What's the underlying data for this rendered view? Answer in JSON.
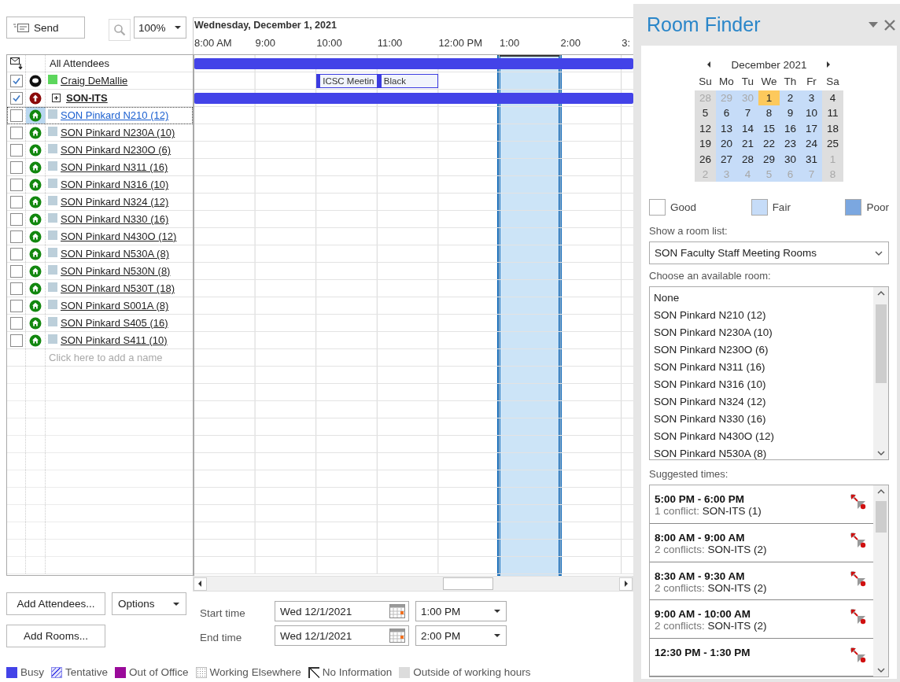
{
  "toolbar": {
    "send": "Send",
    "zoom": "100%"
  },
  "schedule": {
    "date": "Wednesday, December 1, 2021",
    "hours": [
      "8:00 AM",
      "9:00",
      "10:00",
      "11:00",
      "12:00 PM",
      "1:00",
      "2:00",
      "3:"
    ]
  },
  "attendees_header": {
    "label": "All Attendees",
    "busy": true
  },
  "attendees": [
    {
      "name": "Craig DeMallie",
      "kind": "person",
      "checked": true,
      "color": "#5cd65c",
      "selected": false,
      "slots": [
        {
          "kind": "free"
        },
        {
          "kind": "free"
        },
        {
          "kind": "tentative",
          "label": "ICSC Meetin"
        },
        {
          "kind": "tentative",
          "label": "Black"
        }
      ]
    },
    {
      "name": "SON-ITS",
      "kind": "group",
      "checked": true,
      "expanded": false,
      "selected": false,
      "busy": true
    },
    {
      "name": "SON Pinkard N210 (12)",
      "kind": "room",
      "checked": false,
      "color": "#bccfda",
      "selected": true
    },
    {
      "name": "SON Pinkard N230A (10)",
      "kind": "room",
      "checked": false,
      "color": "#bccfda",
      "selected": false
    },
    {
      "name": "SON Pinkard N230O (6)",
      "kind": "room",
      "checked": false,
      "color": "#bccfda",
      "selected": false
    },
    {
      "name": "SON Pinkard N311 (16)",
      "kind": "room",
      "checked": false,
      "color": "#bccfda",
      "selected": false
    },
    {
      "name": "SON Pinkard N316 (10)",
      "kind": "room",
      "checked": false,
      "color": "#bccfda",
      "selected": false
    },
    {
      "name": "SON Pinkard N324 (12)",
      "kind": "room",
      "checked": false,
      "color": "#bccfda",
      "selected": false
    },
    {
      "name": "SON Pinkard N330 (16)",
      "kind": "room",
      "checked": false,
      "color": "#bccfda",
      "selected": false
    },
    {
      "name": "SON Pinkard N430O (12)",
      "kind": "room",
      "checked": false,
      "color": "#bccfda",
      "selected": false
    },
    {
      "name": "SON Pinkard N530A (8)",
      "kind": "room",
      "checked": false,
      "color": "#bccfda",
      "selected": false
    },
    {
      "name": "SON Pinkard N530N (8)",
      "kind": "room",
      "checked": false,
      "color": "#bccfda",
      "selected": false
    },
    {
      "name": "SON Pinkard N530T (18)",
      "kind": "room",
      "checked": false,
      "color": "#bccfda",
      "selected": false
    },
    {
      "name": "SON Pinkard S001A (8)",
      "kind": "room",
      "checked": false,
      "color": "#bccfda",
      "selected": false
    },
    {
      "name": "SON Pinkard S405 (16)",
      "kind": "room",
      "checked": false,
      "color": "#bccfda",
      "selected": false
    },
    {
      "name": "SON Pinkard S411 (10)",
      "kind": "room",
      "checked": false,
      "color": "#bccfda",
      "selected": false
    }
  ],
  "add_name": {
    "placeholder": "Click here to add a name"
  },
  "buttons": {
    "add_attendees": "Add Attendees...",
    "options": "Options",
    "add_rooms": "Add Rooms..."
  },
  "start_time": {
    "label": "Start time",
    "date": "Wed 12/1/2021",
    "time": "1:00 PM"
  },
  "end_time": {
    "label": "End time",
    "date": "Wed 12/1/2021",
    "time": "2:00 PM"
  },
  "legend": [
    {
      "label": "Busy",
      "kind": "busy"
    },
    {
      "label": "Tentative",
      "kind": "tentative"
    },
    {
      "label": "Out of Office",
      "kind": "oof"
    },
    {
      "label": "Working Elsewhere",
      "kind": "elsewhere"
    },
    {
      "label": "No Information",
      "kind": "noinfo"
    },
    {
      "label": "Outside of working hours",
      "kind": "offhours"
    }
  ],
  "room_finder": {
    "title": "Room Finder",
    "month": "December 2021",
    "weekdays": [
      "Su",
      "Mo",
      "Tu",
      "We",
      "Th",
      "Fr",
      "Sa"
    ],
    "weeks": [
      [
        {
          "day": "28",
          "muted": true,
          "selected": false,
          "kind": "offhours"
        },
        {
          "day": "29",
          "muted": true,
          "selected": false,
          "kind": "fair"
        },
        {
          "day": "30",
          "muted": true,
          "selected": false,
          "kind": "fair"
        },
        {
          "day": "1",
          "muted": false,
          "selected": true
        },
        {
          "day": "2",
          "muted": false,
          "selected": false,
          "kind": "fair"
        },
        {
          "day": "3",
          "muted": false,
          "selected": false,
          "kind": "fair"
        },
        {
          "day": "4",
          "muted": false,
          "selected": false,
          "kind": "offhours"
        }
      ],
      [
        {
          "day": "5",
          "muted": false,
          "selected": false,
          "kind": "offhours"
        },
        {
          "day": "6",
          "muted": false,
          "selected": false,
          "kind": "fair"
        },
        {
          "day": "7",
          "muted": false,
          "selected": false,
          "kind": "fair"
        },
        {
          "day": "8",
          "muted": false,
          "selected": false,
          "kind": "fair"
        },
        {
          "day": "9",
          "muted": false,
          "selected": false,
          "kind": "fair"
        },
        {
          "day": "10",
          "muted": false,
          "selected": false,
          "kind": "fair"
        },
        {
          "day": "11",
          "muted": false,
          "selected": false,
          "kind": "offhours"
        }
      ],
      [
        {
          "day": "12",
          "muted": false,
          "selected": false,
          "kind": "offhours"
        },
        {
          "day": "13",
          "muted": false,
          "selected": false,
          "kind": "fair"
        },
        {
          "day": "14",
          "muted": false,
          "selected": false,
          "kind": "fair"
        },
        {
          "day": "15",
          "muted": false,
          "selected": false,
          "kind": "fair"
        },
        {
          "day": "16",
          "muted": false,
          "selected": false,
          "kind": "fair"
        },
        {
          "day": "17",
          "muted": false,
          "selected": false,
          "kind": "fair"
        },
        {
          "day": "18",
          "muted": false,
          "selected": false,
          "kind": "offhours"
        }
      ],
      [
        {
          "day": "19",
          "muted": false,
          "selected": false,
          "kind": "offhours"
        },
        {
          "day": "20",
          "muted": false,
          "selected": false,
          "kind": "fair"
        },
        {
          "day": "21",
          "muted": false,
          "selected": false,
          "kind": "fair"
        },
        {
          "day": "22",
          "muted": false,
          "selected": false,
          "kind": "fair"
        },
        {
          "day": "23",
          "muted": false,
          "selected": false,
          "kind": "fair"
        },
        {
          "day": "24",
          "muted": false,
          "selected": false,
          "kind": "fair"
        },
        {
          "day": "25",
          "muted": false,
          "selected": false,
          "kind": "offhours"
        }
      ],
      [
        {
          "day": "26",
          "muted": false,
          "selected": false,
          "kind": "offhours"
        },
        {
          "day": "27",
          "muted": false,
          "selected": false,
          "kind": "fair"
        },
        {
          "day": "28",
          "muted": false,
          "selected": false,
          "kind": "fair"
        },
        {
          "day": "29",
          "muted": false,
          "selected": false,
          "kind": "fair"
        },
        {
          "day": "30",
          "muted": false,
          "selected": false,
          "kind": "fair"
        },
        {
          "day": "31",
          "muted": false,
          "selected": false,
          "kind": "fair"
        },
        {
          "day": "1",
          "muted": true,
          "selected": false,
          "kind": "offhours"
        }
      ],
      [
        {
          "day": "2",
          "muted": true,
          "selected": false,
          "kind": "offhours"
        },
        {
          "day": "3",
          "muted": true,
          "selected": false,
          "kind": "fair"
        },
        {
          "day": "4",
          "muted": true,
          "selected": false,
          "kind": "fair"
        },
        {
          "day": "5",
          "muted": true,
          "selected": false,
          "kind": "fair"
        },
        {
          "day": "6",
          "muted": true,
          "selected": false,
          "kind": "fair"
        },
        {
          "day": "7",
          "muted": true,
          "selected": false,
          "kind": "fair"
        },
        {
          "day": "8",
          "muted": true,
          "selected": false,
          "kind": "offhours"
        }
      ]
    ],
    "availability": [
      {
        "label": "Good",
        "color": "#ffffff"
      },
      {
        "label": "Fair",
        "color": "#c6dcf8"
      },
      {
        "label": "Poor",
        "color": "#7ba7e0"
      }
    ],
    "room_list_label": "Show a room list:",
    "room_list": "SON Faculty Staff Meeting Rooms",
    "rooms_label": "Choose an available room:",
    "rooms": [
      "None",
      "SON Pinkard N210 (12)",
      "SON Pinkard N230A (10)",
      "SON Pinkard N230O (6)",
      "SON Pinkard N311 (16)",
      "SON Pinkard N316 (10)",
      "SON Pinkard N324 (12)",
      "SON Pinkard N330 (16)",
      "SON Pinkard N430O (12)",
      "SON Pinkard N530A (8)"
    ],
    "suggested_label": "Suggested times:",
    "suggested": [
      {
        "time": "5:00 PM - 6:00 PM",
        "conflicts": "1 conflict:",
        "detail": "SON-ITS (1)"
      },
      {
        "time": "8:00 AM - 9:00 AM",
        "conflicts": "2 conflicts:",
        "detail": "SON-ITS (2)"
      },
      {
        "time": "8:30 AM - 9:30 AM",
        "conflicts": "2 conflicts:",
        "detail": "SON-ITS (2)"
      },
      {
        "time": "9:00 AM - 10:00 AM",
        "conflicts": "2 conflicts:",
        "detail": "SON-ITS (2)"
      },
      {
        "time": "12:30 PM - 1:30 PM"
      }
    ]
  }
}
